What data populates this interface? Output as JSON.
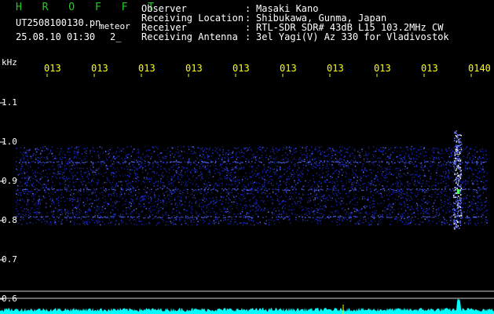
{
  "header": {
    "brand": "H R O F F T",
    "filename": "UT2508100130.pn",
    "tag": "meteor",
    "datetime": "25.08.10 01:30",
    "extra": "2_"
  },
  "info": [
    {
      "label": "Observer",
      "value": "Masaki Kano"
    },
    {
      "label": "Receiving Location",
      "value": "Shibukawa, Gunma, Japan"
    },
    {
      "label": "Receiver",
      "value": "RTL-SDR SDR# 43dB L15 103.2MHz CW"
    },
    {
      "label": "Receiving Antenna",
      "value": "3el Yagi(V) Az 330 for Vladivostok"
    }
  ],
  "separator": ":",
  "y_unit": "kHz",
  "y_ticks": [
    "1.1",
    "1.0",
    "0.9",
    "0.8",
    "0.7",
    "0.6"
  ],
  "time_ticks": [
    "013",
    "013",
    "013",
    "013",
    "013",
    "013",
    "013",
    "013",
    "013",
    "0140"
  ],
  "colors": {
    "background": "#000000",
    "noise": "#1a2bd6",
    "noise_bright": "#6a7cff",
    "event": "#ffffff",
    "tick_label": "#ffff00",
    "brand": "#22cc22",
    "baseline": "#00ffff"
  },
  "spectrogram": {
    "band_khz": [
      0.79,
      0.99
    ],
    "lines_khz": [
      0.88,
      0.95,
      0.81
    ],
    "event_time_fraction": 0.94
  }
}
